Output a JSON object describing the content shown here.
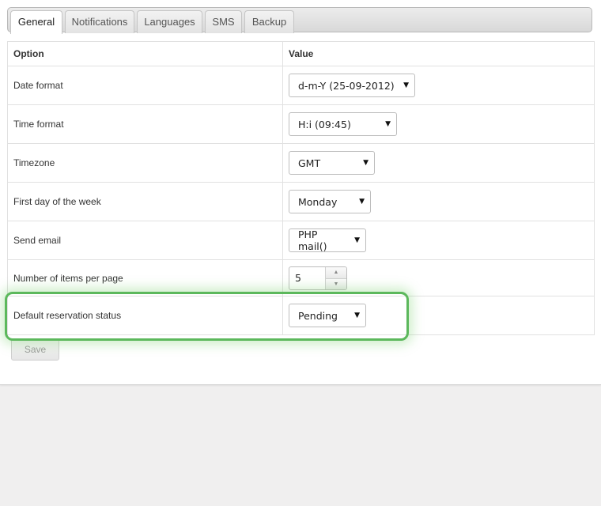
{
  "tabs": [
    {
      "label": "General",
      "active": true
    },
    {
      "label": "Notifications",
      "active": false
    },
    {
      "label": "Languages",
      "active": false
    },
    {
      "label": "SMS",
      "active": false
    },
    {
      "label": "Backup",
      "active": false
    }
  ],
  "table": {
    "headers": {
      "option": "Option",
      "value": "Value"
    },
    "rows": [
      {
        "option": "Date format",
        "value": "d-m-Y (25-09-2012)"
      },
      {
        "option": "Time format",
        "value": "H:i (09:45)"
      },
      {
        "option": "Timezone",
        "value": "GMT"
      },
      {
        "option": "First day of the week",
        "value": "Monday"
      },
      {
        "option": "Send email",
        "value": "PHP mail()"
      },
      {
        "option": "Number of items per page",
        "value": "5"
      },
      {
        "option": "Default reservation status",
        "value": "Pending"
      }
    ]
  },
  "icons": {
    "select_caret": "▼",
    "stepper_up": "▲",
    "stepper_down": "▼"
  },
  "save_label": "Save",
  "colors": {
    "highlight": "#5cb85c",
    "panel_bg": "#ffffff",
    "page_bg": "#f0efef"
  }
}
